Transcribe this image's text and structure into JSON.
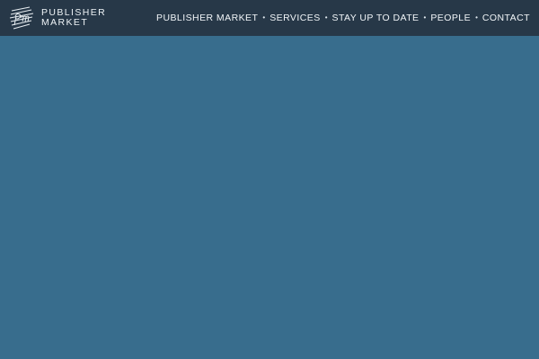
{
  "header": {
    "logo": {
      "line1": "PUBLISHER",
      "line2": "MARKET",
      "mark_icon": "pm-monogram-icon"
    },
    "nav": {
      "separator": "•",
      "items": [
        {
          "label": "PUBLISHER MARKET"
        },
        {
          "label": "SERVICES"
        },
        {
          "label": "STAY UP TO DATE"
        },
        {
          "label": "PEOPLE"
        },
        {
          "label": "CONTACT"
        }
      ]
    }
  },
  "colors": {
    "header_bg": "#273848",
    "page_bg": "#386d8d",
    "text": "#f1f5f8"
  }
}
